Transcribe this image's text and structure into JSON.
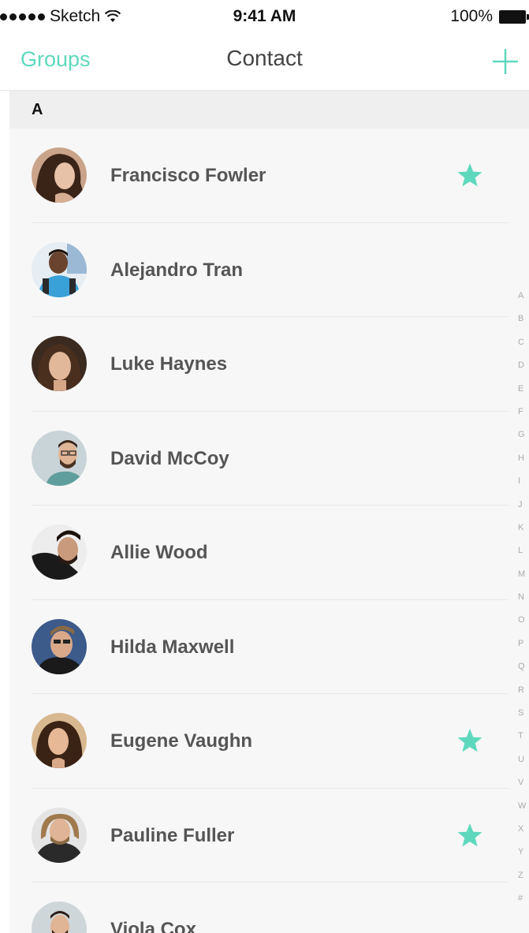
{
  "status_bar": {
    "carrier": "Sketch",
    "time": "9:41 AM",
    "battery": "100%"
  },
  "nav": {
    "left_label": "Groups",
    "title": "Contact",
    "add_icon": "plus-icon"
  },
  "section": {
    "letter": "A"
  },
  "contacts": [
    {
      "name": "Francisco Fowler",
      "starred": true
    },
    {
      "name": "Alejandro Tran",
      "starred": false
    },
    {
      "name": "Luke Haynes",
      "starred": false
    },
    {
      "name": "David McCoy",
      "starred": false
    },
    {
      "name": "Allie Wood",
      "starred": false
    },
    {
      "name": "Hilda Maxwell",
      "starred": false
    },
    {
      "name": "Eugene Vaughn",
      "starred": true
    },
    {
      "name": "Pauline Fuller",
      "starred": true
    },
    {
      "name": "Viola Cox",
      "starred": false
    }
  ],
  "index_letters": [
    "A",
    "B",
    "C",
    "D",
    "E",
    "F",
    "G",
    "H",
    "I",
    "J",
    "K",
    "L",
    "M",
    "N",
    "O",
    "P",
    "Q",
    "R",
    "S",
    "T",
    "U",
    "V",
    "W",
    "X",
    "Y",
    "Z",
    "#"
  ],
  "colors": {
    "accent": "#5ed8bd",
    "background": "#f7f7f7",
    "name_text": "#555555"
  }
}
